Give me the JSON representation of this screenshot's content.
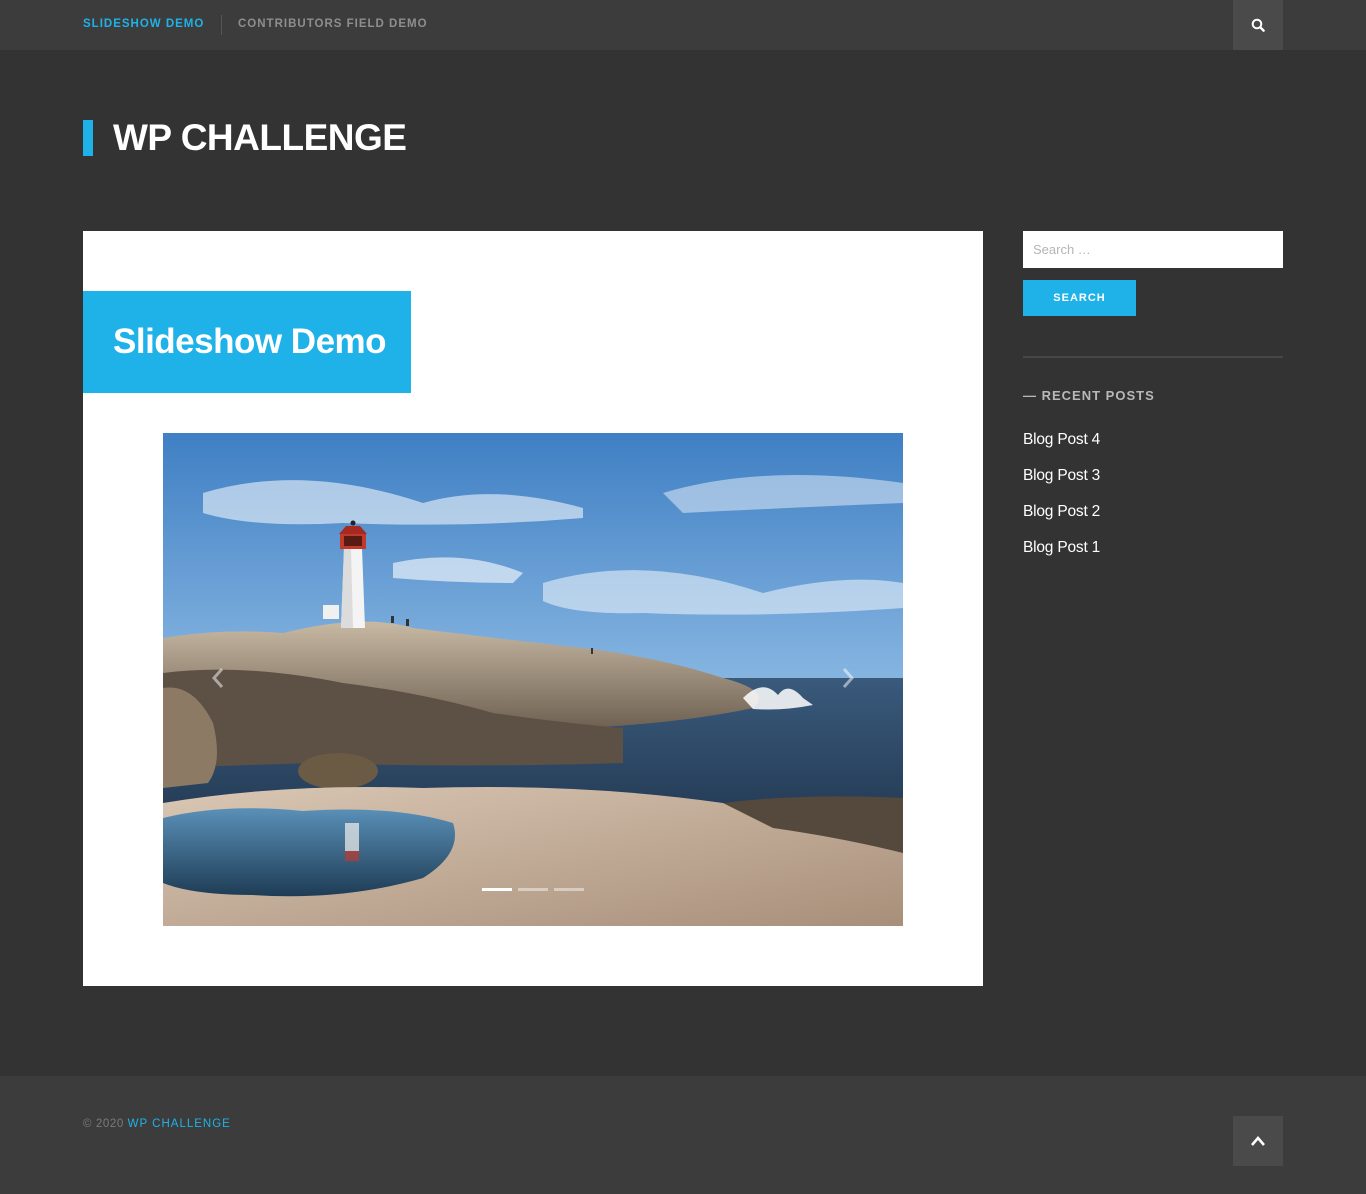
{
  "nav": {
    "items": [
      {
        "label": "SLIDESHOW DEMO"
      },
      {
        "label": "CONTRIBUTORS FIELD DEMO"
      }
    ],
    "search_toggle_icon": "search-icon"
  },
  "site": {
    "title": "WP CHALLENGE",
    "accent": "#1fb2e8"
  },
  "post": {
    "title": "Slideshow Demo",
    "slideshow": {
      "slide_count": 3,
      "active_slide": 1
    }
  },
  "sidebar": {
    "search_placeholder": "Search …",
    "search_button": "SEARCH",
    "recent_title": "— RECENT POSTS",
    "recent_posts": [
      {
        "label": "Blog Post 4"
      },
      {
        "label": "Blog Post 3"
      },
      {
        "label": "Blog Post 2"
      },
      {
        "label": "Blog Post 1"
      }
    ]
  },
  "footer": {
    "copyright_prefix": "© 2020",
    "site_link": "WP CHALLENGE",
    "back_to_top_icon": "chevron-up-icon"
  }
}
